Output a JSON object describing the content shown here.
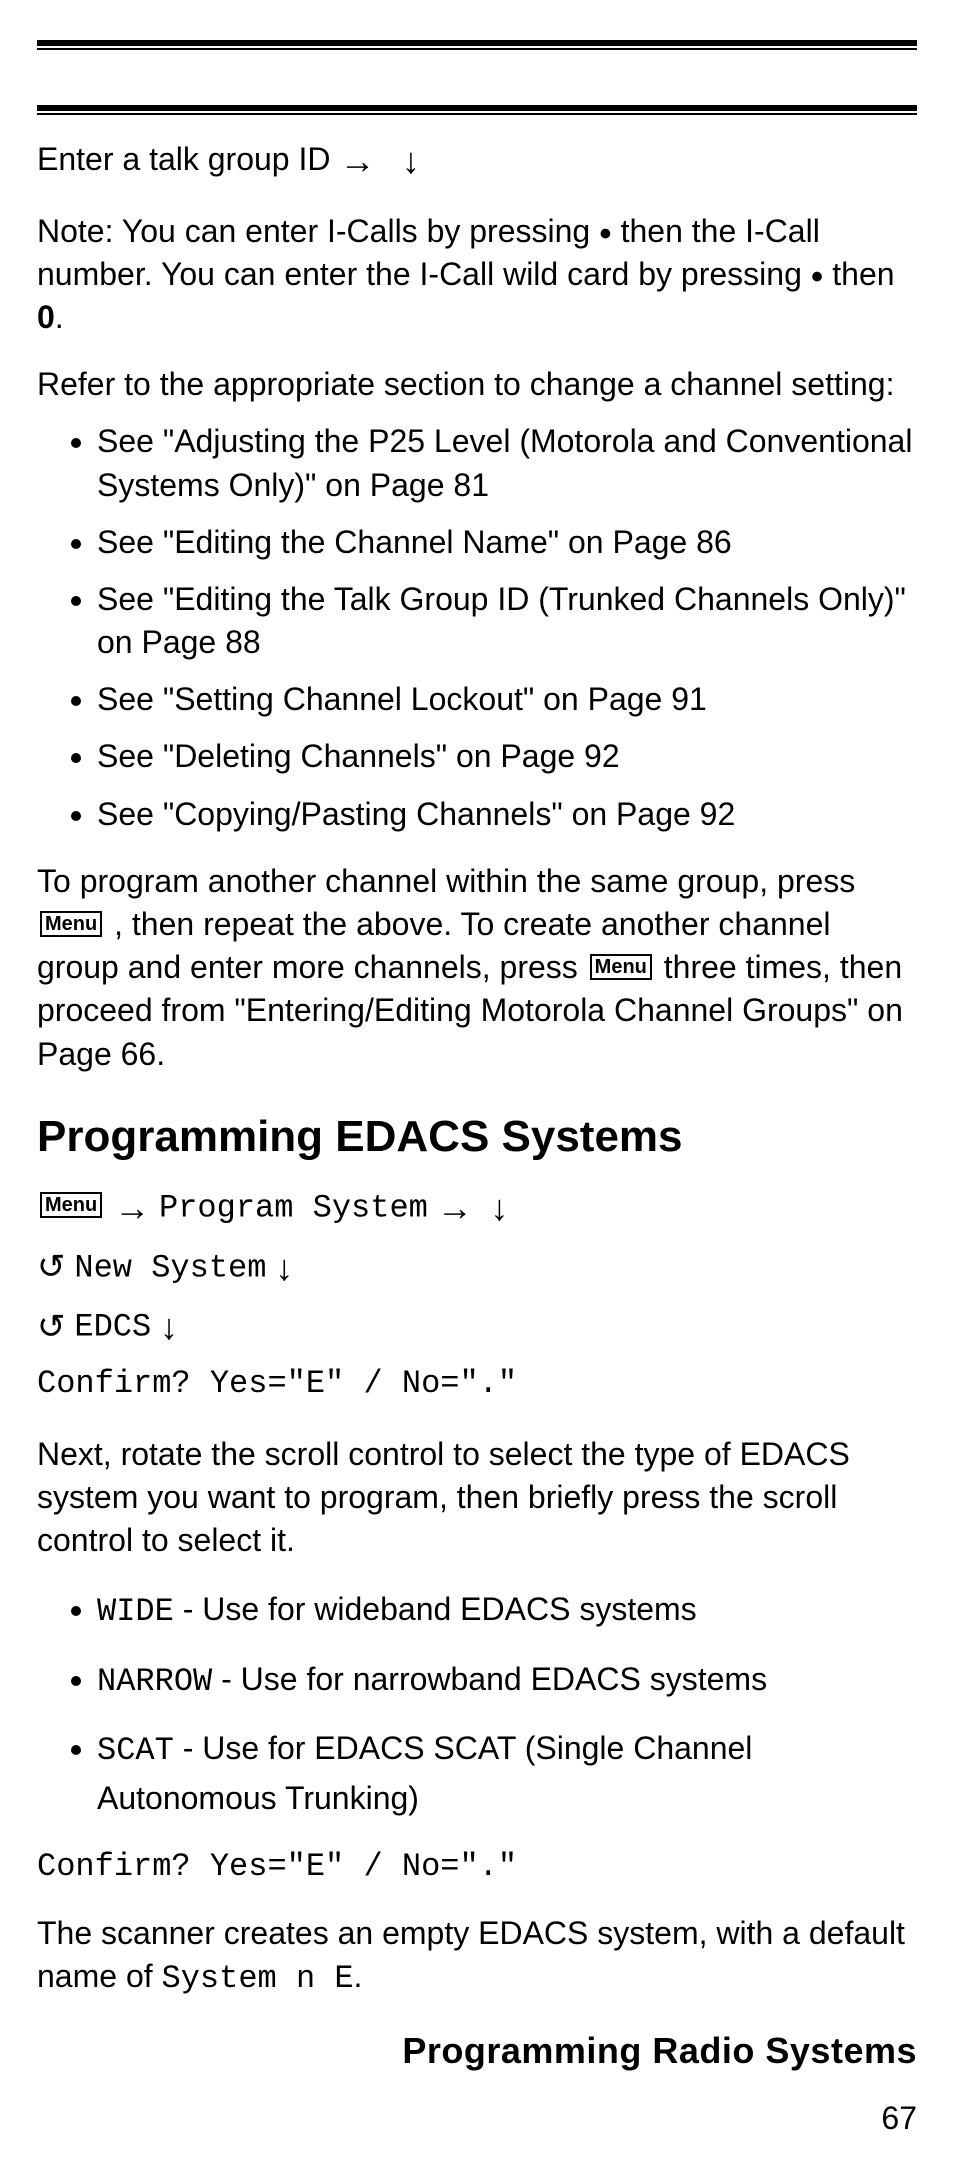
{
  "glyphs": {
    "arrowRight": "→",
    "arrowDown": "↓",
    "dot": "•",
    "rotate": "↺",
    "bullet": "•"
  },
  "menuLabel": "Menu",
  "top": {
    "line1_a": "Enter a talk group ID ",
    "note_a": "Note: You can enter I-Calls by pressing ",
    "note_b": " then the I-Call number.  You can enter the I-Call wild card by pressing ",
    "note_c": " then ",
    "note_zero": "0",
    "note_d": ".",
    "refer": "Refer to the appropriate section to change a channel setting:"
  },
  "xrefs": [
    "See \"Adjusting the P25 Level (Motorola and Conventional Systems Only)\" on Page 81",
    "See \"Editing the Channel Name\" on Page 86",
    "See \"Editing the Talk Group ID (Trunked Channels Only)\" on Page 88",
    "See \"Setting Channel Lockout\" on Page 91",
    "See \"Deleting Channels\" on Page 92",
    "See \"Copying/Pasting Channels\" on Page 92"
  ],
  "another": {
    "a": "To program another channel within the same group, press ",
    "b": " , then repeat the above. To create another channel group and enter more channels, press ",
    "c": " three times, then proceed from \"Entering/Editing Motorola Channel Groups\" on Page 66."
  },
  "heading": "Programming EDACS Systems",
  "steps": {
    "s1": "Program System",
    "s2": "New System",
    "s3": "EDCS",
    "confirm": "Confirm? Yes=\"E\" / No=\".\""
  },
  "nextPara": "Next, rotate the scroll control to select the type of EDACS system you want to program, then briefly press the scroll control to select it.",
  "types": [
    {
      "code": "WIDE",
      "desc": " - Use for wideband EDACS systems"
    },
    {
      "code": "NARROW",
      "desc": " - Use for narrowband EDACS systems"
    },
    {
      "code": "SCAT",
      "desc": " - Use for EDACS SCAT (Single Channel Autonomous Trunking)"
    }
  ],
  "confirm2": "Confirm? Yes=\"E\" / No=\".\"",
  "creates_a": "The scanner creates an empty EDACS system, with a default name of ",
  "creates_code": "System n       E",
  "creates_b": ".",
  "footerTitle": "Programming Radio Systems",
  "pageNum": "67"
}
